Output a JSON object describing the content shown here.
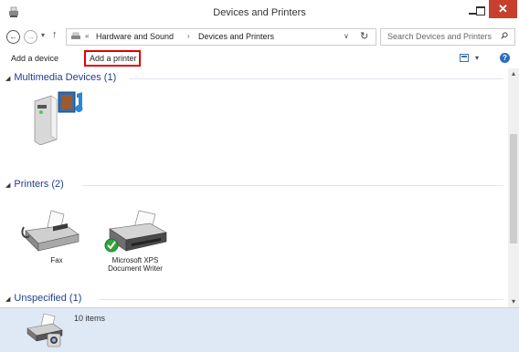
{
  "window": {
    "title": "Devices and Printers",
    "close": "✕"
  },
  "nav": {
    "back": "←",
    "forward": "→",
    "recent": "▾",
    "up": "↑"
  },
  "address": {
    "prefix": "«",
    "crumbs": [
      "Hardware and Sound",
      "Devices and Printers"
    ],
    "separator": "›",
    "dropdown": "∨",
    "refresh": "↻"
  },
  "search": {
    "placeholder": "Search Devices and Printers"
  },
  "toolbar": {
    "add_device": "Add a device",
    "add_printer": "Add a printer",
    "view_drop": "▾",
    "help": "?"
  },
  "groups": [
    {
      "label": "Multimedia Devices (1)",
      "devices": [
        {
          "name": ""
        }
      ]
    },
    {
      "label": "Printers (2)",
      "devices": [
        {
          "name": "Fax"
        },
        {
          "name": "Microsoft XPS Document Writer"
        }
      ]
    },
    {
      "label": "Unspecified (1)",
      "devices": []
    }
  ],
  "group_arrow": "◢",
  "scrollbar": {
    "up": "▴",
    "down": "▾"
  },
  "details": {
    "count_text": "10 items"
  }
}
